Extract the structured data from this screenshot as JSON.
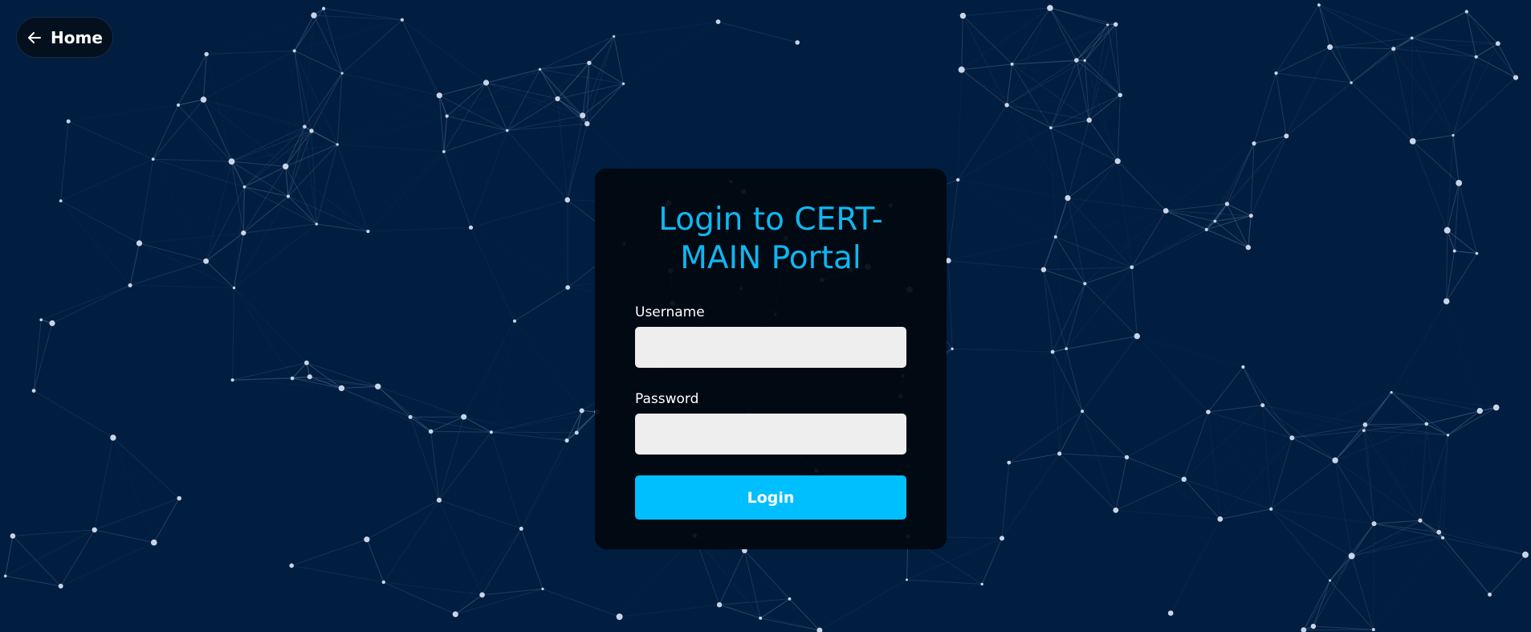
{
  "nav": {
    "home_label": "Home"
  },
  "login": {
    "title": "Login to CERT-MAIN Portal",
    "username_label": "Username",
    "username_value": "",
    "password_label": "Password",
    "password_value": "",
    "submit_label": "Login"
  },
  "colors": {
    "background": "#011d40",
    "accent": "#00bfff",
    "title": "#0fb7f0",
    "card": "#01080f"
  },
  "icons": {
    "home": "arrow-left-icon"
  }
}
